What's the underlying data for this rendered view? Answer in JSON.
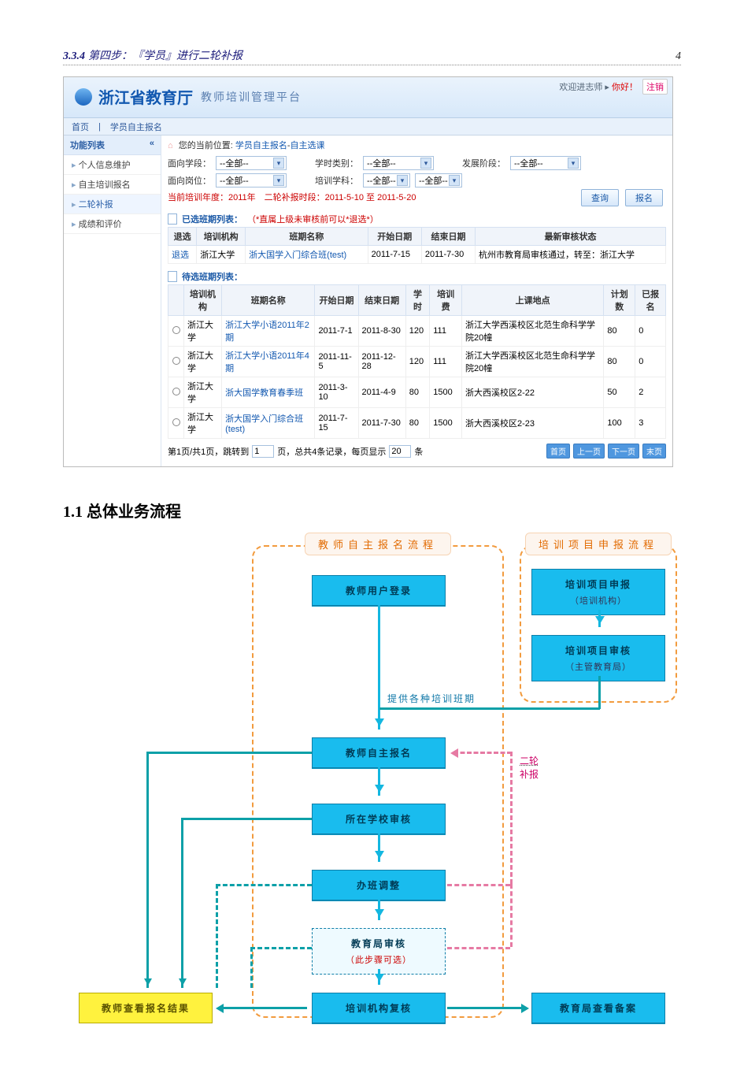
{
  "toc": {
    "num": "3.3.4",
    "title": "第四步：『学员』进行二轮补报",
    "page": "4"
  },
  "app": {
    "header": {
      "org": "浙江省教育厅",
      "subtitle": "教师培训管理平台",
      "welcome_prefix": "欢迎进志师 ▸ ",
      "welcome_name": "你好！",
      "logout": "注销"
    },
    "menubar": {
      "item1": "首页",
      "item2": "学员自主报名"
    },
    "sidebar": {
      "title": "功能列表",
      "items": [
        "个人信息维护",
        "自主培训报名",
        "二轮补报",
        "成绩和评价"
      ]
    },
    "breadcrumb": {
      "icon": "⌂",
      "label": "您的当前位置:",
      "path1": "学员自主报名",
      "path2": "自主选课"
    },
    "filters": {
      "lbl_stage": "面向学段：",
      "val_stage": "--全部--",
      "lbl_credit": "学时类别：",
      "val_credit": "--全部--",
      "lbl_phase": "发展阶段：",
      "val_phase": "--全部--",
      "lbl_post": "面向岗位：",
      "val_post": "--全部--",
      "lbl_subject": "培训学科：",
      "val_subject1": "--全部--",
      "val_subject2": "--全部--",
      "info_red": "当前培训年度：2011年　二轮补报时段：2011-5-10 至 2011-5-20",
      "btn_query": "查询",
      "btn_signup": "报名"
    },
    "table1": {
      "title": "已选班期列表：",
      "note": "（*直属上级未审核前可以*退选*）",
      "headers": [
        "退选",
        "培训机构",
        "班期名称",
        "开始日期",
        "结束日期",
        "最新审核状态"
      ],
      "row": {
        "action": "退选",
        "org": "浙江大学",
        "name": "浙大国学入门综合班(test)",
        "start": "2011-7-15",
        "end": "2011-7-30",
        "status": "杭州市教育局审核通过，转至：浙江大学"
      }
    },
    "table2": {
      "title": "待选班期列表：",
      "headers": [
        "",
        "培训机构",
        "班期名称",
        "开始日期",
        "结束日期",
        "学时",
        "培训费",
        "上课地点",
        "计划数",
        "已报名"
      ],
      "rows": [
        {
          "org": "浙江大学",
          "name": "浙江大学小语2011年2期",
          "start": "2011-7-1",
          "end": "2011-8-30",
          "hours": "120",
          "fee": "111",
          "loc": "浙江大学西溪校区北范生命科学学院20幢",
          "plan": "80",
          "signed": "0"
        },
        {
          "org": "浙江大学",
          "name": "浙江大学小语2011年4期",
          "start": "2011-11-5",
          "end": "2011-12-28",
          "hours": "120",
          "fee": "111",
          "loc": "浙江大学西溪校区北范生命科学学院20幢",
          "plan": "80",
          "signed": "0"
        },
        {
          "org": "浙江大学",
          "name": "浙大国学教育春季班",
          "start": "2011-3-10",
          "end": "2011-4-9",
          "hours": "80",
          "fee": "1500",
          "loc": "浙大西溪校区2-22",
          "plan": "50",
          "signed": "2"
        },
        {
          "org": "浙江大学",
          "name": "浙大国学入门综合班(test)",
          "start": "2011-7-15",
          "end": "2011-7-30",
          "hours": "80",
          "fee": "1500",
          "loc": "浙大西溪校区2-23",
          "plan": "100",
          "signed": "3"
        }
      ]
    },
    "pager": {
      "text1": "第1页/共1页，跳转到",
      "jump_val": "1",
      "text2": "页，总共4条记录，每页显示",
      "size_val": "20",
      "text3": "条",
      "btn_first": "首页",
      "btn_prev": "上一页",
      "btn_next": "下一页",
      "btn_last": "末页"
    }
  },
  "heading11": "1.1 总体业务流程",
  "flow": {
    "lane_teacher": "教师自主报名流程",
    "lane_project": "培训项目申报流程",
    "n_login": "教师用户登录",
    "n_signup": "教师自主报名",
    "n_school": "所在学校审核",
    "n_adjust": "办班调整",
    "n_edu_check": "教育局审核",
    "n_edu_check_sub": "（此步骤可选）",
    "n_org_check": "培训机构复核",
    "n_result": "教师查看报名结果",
    "n_edu_record": "教育局查看备案",
    "n_proj_apply": "培训项目申报",
    "n_proj_apply_sub": "（培训机构）",
    "n_proj_check": "培训项目审核",
    "n_proj_check_sub": "（主管教育局）",
    "label_provide": "提供各种培训班期",
    "label_round2a": "二轮",
    "label_round2b": "补报"
  }
}
